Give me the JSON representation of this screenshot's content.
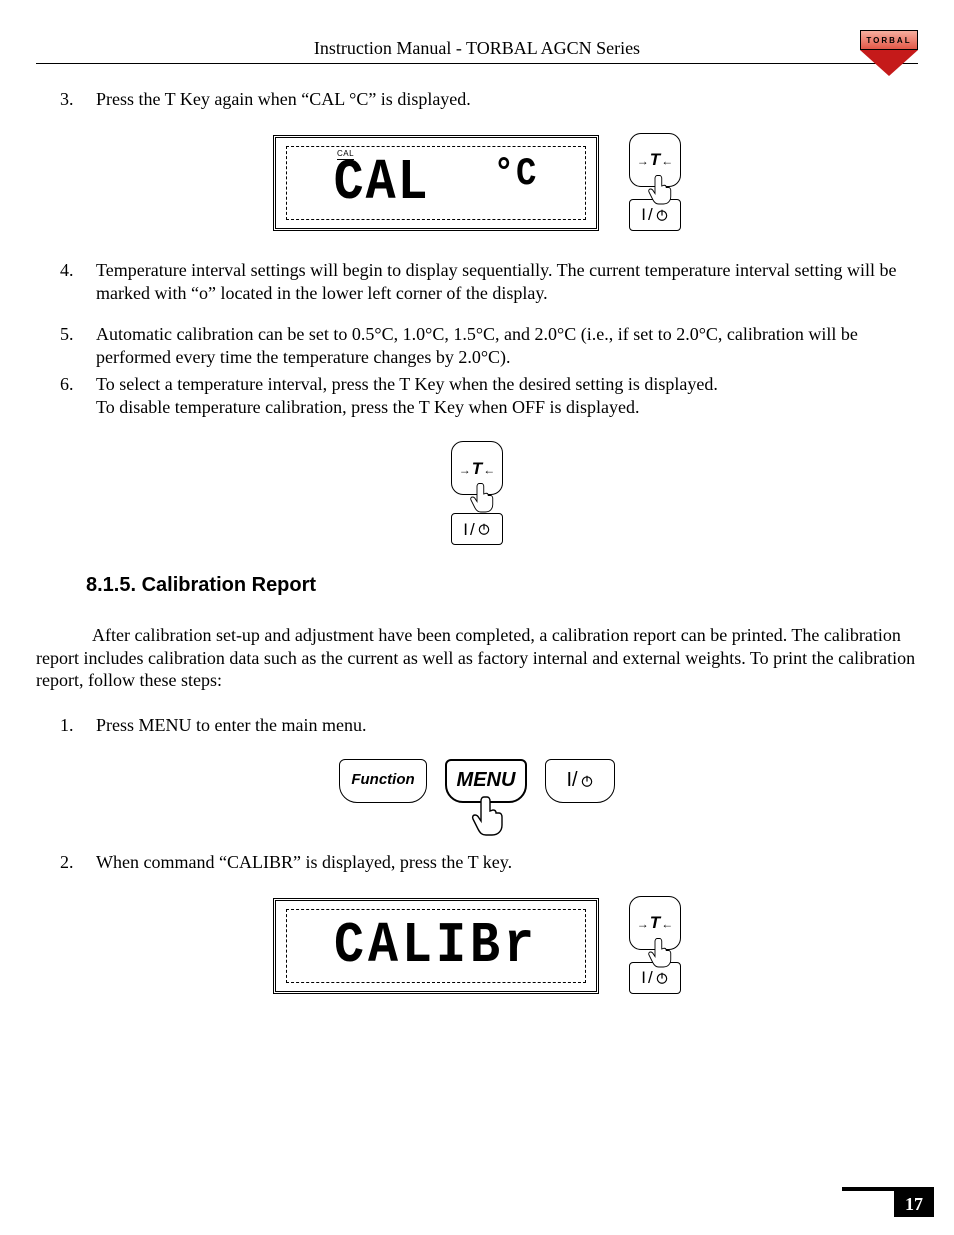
{
  "header": {
    "title": "Instruction Manual - TORBAL AGCN Series",
    "logo_text": "TORBAL"
  },
  "list1": {
    "items": [
      {
        "num": "3.",
        "text": "Press the T Key again when “CAL °C” is displayed."
      }
    ]
  },
  "fig1": {
    "lcd_small": "CAL",
    "lcd_main": "CAL",
    "lcd_deg": "°C",
    "t_label": "T",
    "power_bar": "I",
    "power_slash": "/"
  },
  "list2": {
    "items": [
      {
        "num": "4.",
        "text": "Temperature interval settings will begin to display sequentially. The current temperature interval setting will be marked with “o” located in the lower left corner of the display."
      },
      {
        "num": "5.",
        "text": "Automatic calibration can be set to 0.5°C, 1.0°C, 1.5°C, and 2.0°C (i.e., if set to 2.0°C, calibration will be performed every time the temperature changes by 2.0°C)."
      },
      {
        "num": "6.",
        "text": "To select a temperature interval, press the T Key when the desired setting is displayed.",
        "text2": "To disable temperature calibration, press the T Key when OFF is displayed."
      }
    ]
  },
  "fig2": {
    "t_label": "T",
    "power_bar": "I",
    "power_slash": "/"
  },
  "section": {
    "number": "8.1.5.",
    "title": "Calibration Report"
  },
  "intro": "After calibration set-up and adjustment have been completed, a calibration report can be printed.  The calibration report includes calibration data such as the current as well as factory internal and external weights.   To print the calibration report, follow these steps:",
  "list3": {
    "items": [
      {
        "num": "1.",
        "text": "Press MENU to enter the main menu."
      }
    ]
  },
  "fig3": {
    "function_label": "Function",
    "menu_label": "MENU",
    "power_bar": "I",
    "power_slash": "/"
  },
  "list4": {
    "items": [
      {
        "num": "2.",
        "text": "When command “CALIBR” is displayed, press the T key."
      }
    ]
  },
  "fig4": {
    "lcd_main": "CALIBr",
    "t_label": "T",
    "power_bar": "I",
    "power_slash": "/"
  },
  "page_number": "17"
}
